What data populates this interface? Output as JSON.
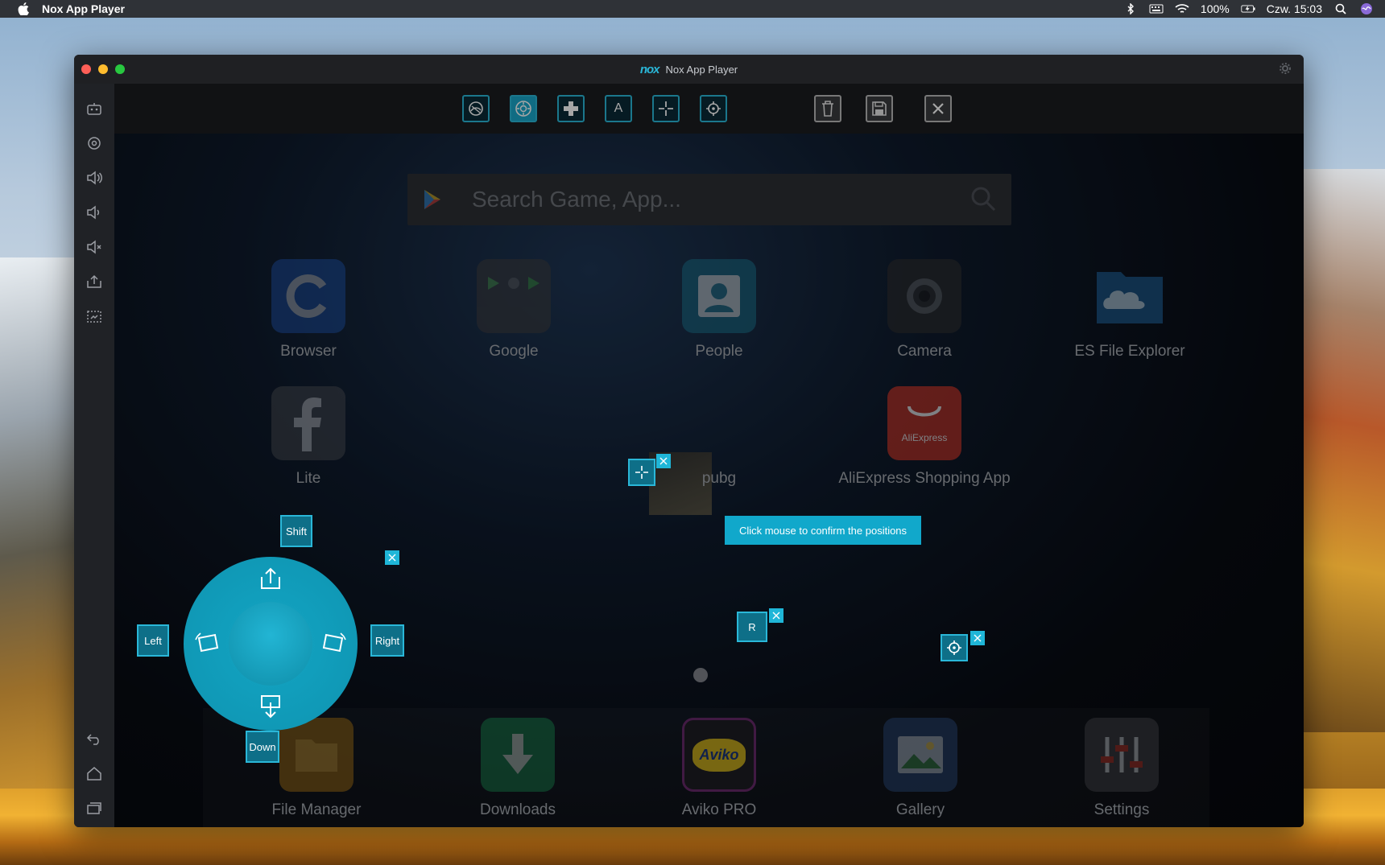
{
  "menubar": {
    "app_name": "Nox App Player",
    "battery": "100%",
    "clock": "Czw. 15:03"
  },
  "window": {
    "title": "Nox App Player",
    "logo_text": "nox"
  },
  "toolbar": {
    "buttons": [
      {
        "name": "gesture"
      },
      {
        "name": "joystick"
      },
      {
        "name": "dpad"
      },
      {
        "name": "key-a",
        "label": "A"
      },
      {
        "name": "crosshair"
      },
      {
        "name": "fire"
      },
      {
        "name": "delete"
      },
      {
        "name": "save"
      },
      {
        "name": "close"
      }
    ]
  },
  "search": {
    "placeholder": "Search Game, App..."
  },
  "apps": {
    "row1": [
      "Browser",
      "Google",
      "People",
      "Camera",
      "ES File Explorer"
    ],
    "row2": [
      "Lite",
      "pubg",
      "AliExpress Shopping App"
    ],
    "aliexpress_icon_text": "AliExpress",
    "dock": [
      "File Manager",
      "Downloads",
      "Aviko PRO",
      "Gallery",
      "Settings"
    ],
    "aviko_icon_text": "Aviko"
  },
  "keymap": {
    "shift": "Shift",
    "left": "Left",
    "right": "Right",
    "down": "Down",
    "r_key": "R",
    "tooltip": "Click mouse to confirm the positions"
  },
  "colors": {
    "accent": "#2ab7d8",
    "menubar": "#2f3237",
    "window_bg": "#1c1d20"
  }
}
